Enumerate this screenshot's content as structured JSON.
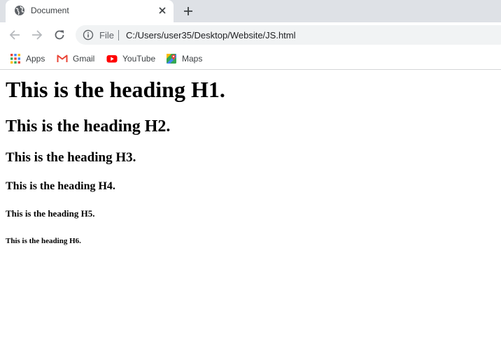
{
  "tab": {
    "title": "Document",
    "favicon": "globe-icon"
  },
  "toolbar": {
    "back_icon": "arrow-back-icon",
    "forward_icon": "arrow-forward-icon",
    "reload_icon": "reload-icon",
    "omnibox": {
      "info_icon": "info-icon",
      "scheme": "File",
      "url": "C:/Users/user35/Desktop/Website/JS.html"
    }
  },
  "bookmarks": [
    {
      "label": "Apps",
      "icon": "apps-grid-icon"
    },
    {
      "label": "Gmail",
      "icon": "gmail-icon"
    },
    {
      "label": "YouTube",
      "icon": "youtube-icon"
    },
    {
      "label": "Maps",
      "icon": "maps-icon"
    }
  ],
  "colors": {
    "tabstrip": "#dee1e6",
    "omnibox": "#f1f3f4",
    "gmail_red": "#ea4335",
    "youtube_red": "#ff0000"
  },
  "page": {
    "h1": "This is the heading H1.",
    "h2": "This is the heading H2.",
    "h3": "This is the heading H3.",
    "h4": "This is the heading H4.",
    "h5": "This is the heading H5.",
    "h6": "This is the heading H6."
  }
}
